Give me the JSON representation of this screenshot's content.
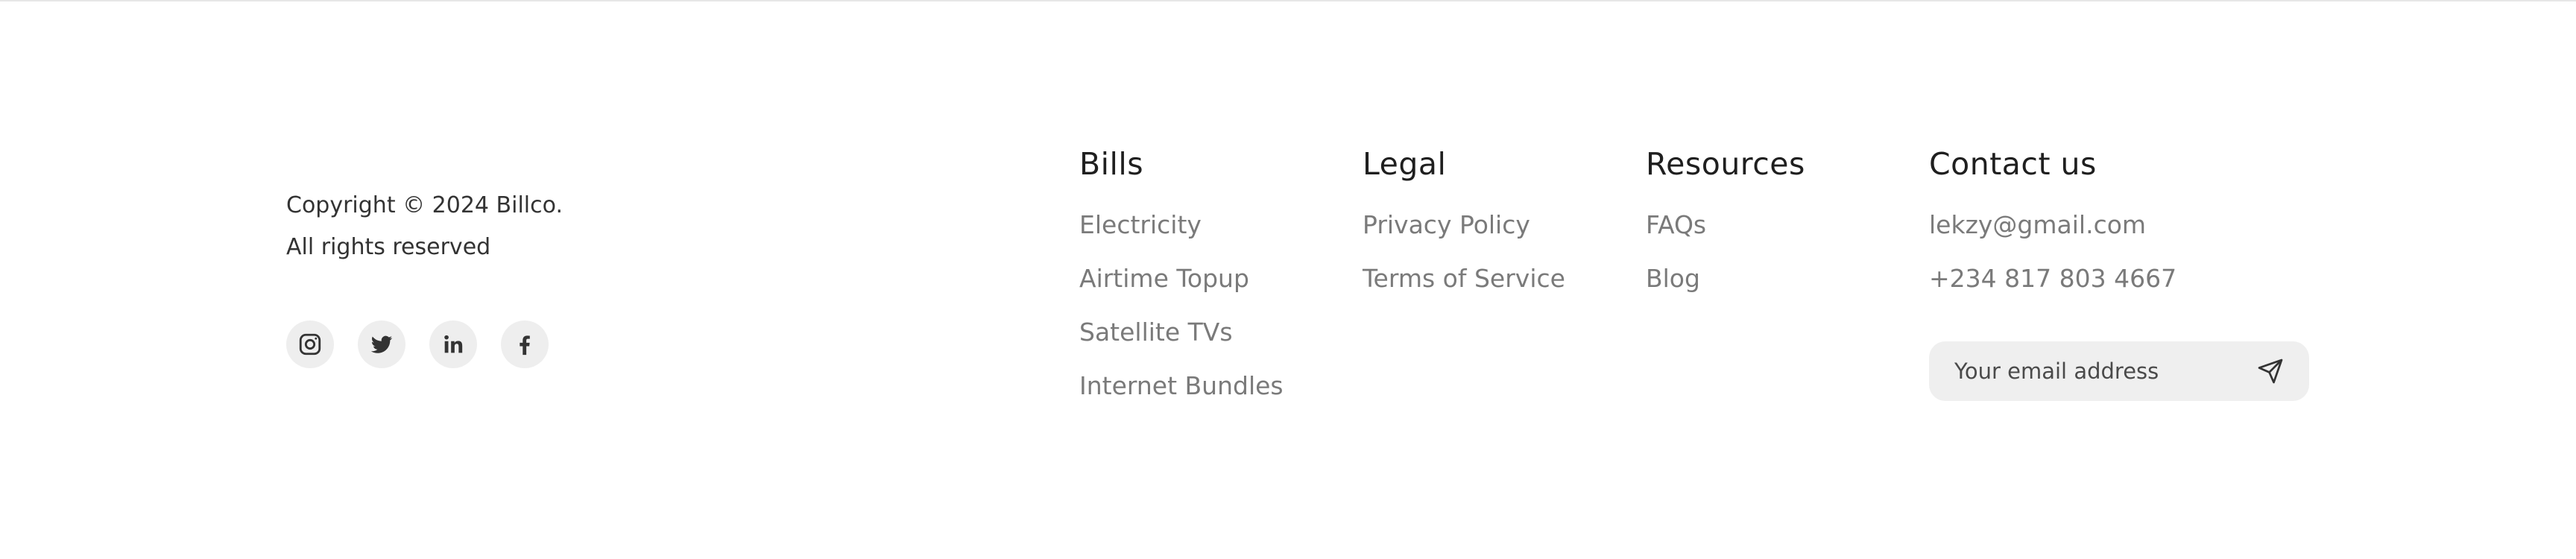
{
  "footer": {
    "copyright_line1": "Copyright © 2024 Billco.",
    "copyright_line2": "All rights reserved",
    "socials": [
      {
        "icon": "instagram-icon"
      },
      {
        "icon": "twitter-icon"
      },
      {
        "icon": "linkedin-icon"
      },
      {
        "icon": "facebook-icon"
      }
    ],
    "bills": {
      "title": "Bills",
      "items": [
        "Electricity",
        "Airtime Topup",
        "Satellite TVs",
        "Internet Bundles"
      ]
    },
    "legal": {
      "title": "Legal",
      "items": [
        "Privacy Policy",
        "Terms of Service"
      ]
    },
    "resources": {
      "title": "Resources",
      "items": [
        "FAQs",
        "Blog"
      ]
    },
    "contact": {
      "title": "Contact us",
      "email": "lekzy@gmail.com",
      "phone": "+234 817 803 4667",
      "newsletter_placeholder": "Your email address"
    },
    "colors": {
      "heading": "#1f1f1f",
      "link": "#7a7a7a",
      "icon_bg": "#eeeeee",
      "input_bg": "#efefef"
    }
  }
}
